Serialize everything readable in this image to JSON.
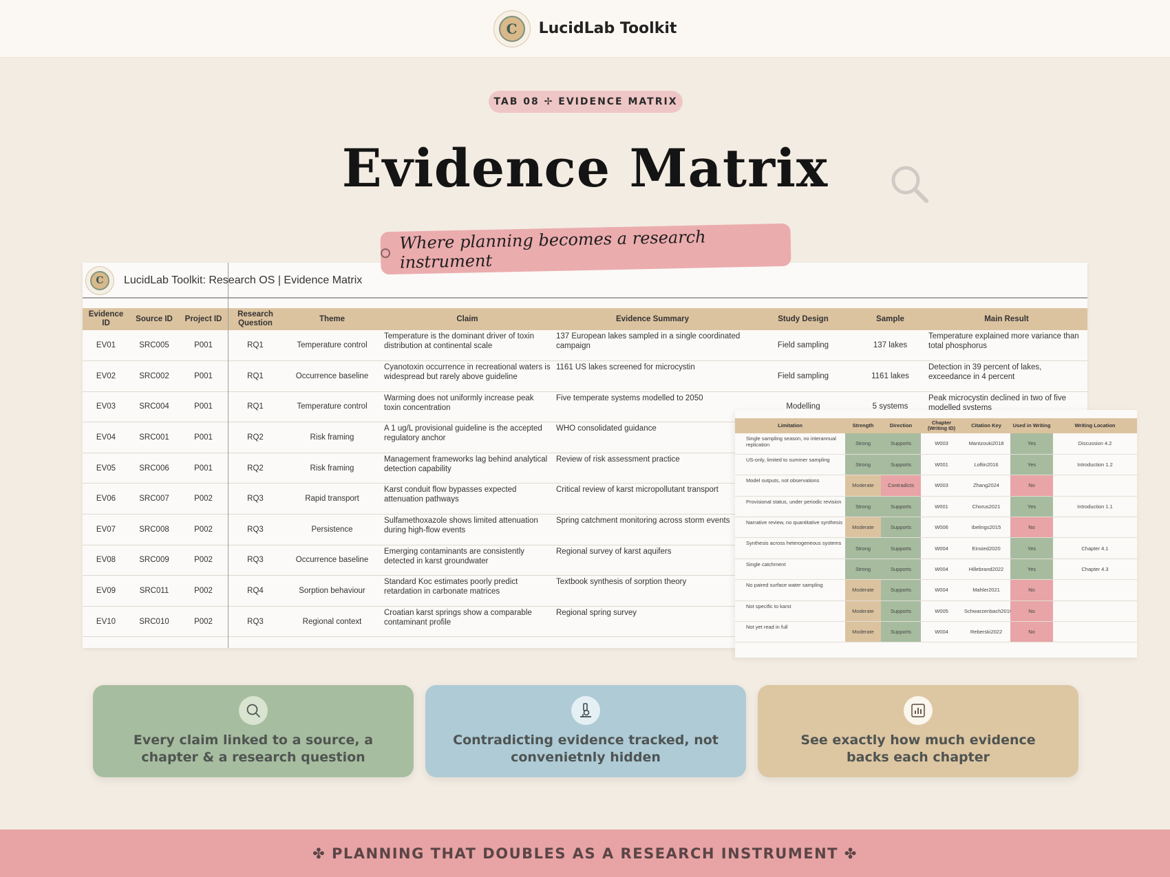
{
  "header": {
    "brand": "LucidLab Toolkit"
  },
  "hero": {
    "tag": "TAB 08 ✢ EVIDENCE MATRIX",
    "title": "Evidence Matrix",
    "tagline": "Where planning becomes a research instrument"
  },
  "sheet": {
    "title": "LucidLab Toolkit: Research OS  |  Evidence Matrix",
    "columns": [
      "Evidence ID",
      "Source ID",
      "Project ID",
      "Research Question",
      "Theme",
      "Claim",
      "Evidence Summary",
      "Study Design",
      "Sample",
      "Main Result"
    ],
    "rows": [
      [
        "EV01",
        "SRC005",
        "P001",
        "RQ1",
        "Temperature control",
        "Temperature is the dominant driver of toxin distribution at continental scale",
        "137 European lakes sampled in a single coordinated campaign",
        "Field sampling",
        "137 lakes",
        "Temperature explained more variance than total phosphorus"
      ],
      [
        "EV02",
        "SRC002",
        "P001",
        "RQ1",
        "Occurrence baseline",
        "Cyanotoxin occurrence in recreational waters is widespread but rarely above guideline",
        "1161 US lakes screened for microcystin",
        "Field sampling",
        "1161 lakes",
        "Detection in 39 percent of lakes, exceedance in 4 percent"
      ],
      [
        "EV03",
        "SRC004",
        "P001",
        "RQ1",
        "Temperature control",
        "Warming does not uniformly increase peak toxin concentration",
        "Five temperate systems modelled to 2050",
        "Modelling",
        "5 systems",
        "Peak microcystin declined in two of five modelled systems"
      ],
      [
        "EV04",
        "SRC001",
        "P001",
        "RQ2",
        "Risk framing",
        "A 1 ug/L provisional guideline is the accepted regulatory anchor",
        "WHO consolidated guidance",
        "",
        "",
        ""
      ],
      [
        "EV05",
        "SRC006",
        "P001",
        "RQ2",
        "Risk framing",
        "Management frameworks lag behind analytical detection capability",
        "Review of risk assessment practice",
        "",
        "",
        ""
      ],
      [
        "EV06",
        "SRC007",
        "P002",
        "RQ3",
        "Rapid transport",
        "Karst conduit flow bypasses expected attenuation pathways",
        "Critical review of karst micropollutant transport",
        "",
        "",
        ""
      ],
      [
        "EV07",
        "SRC008",
        "P002",
        "RQ3",
        "Persistence",
        "Sulfamethoxazole shows limited attenuation during high-flow events",
        "Spring catchment monitoring across storm events",
        "",
        "",
        ""
      ],
      [
        "EV08",
        "SRC009",
        "P002",
        "RQ3",
        "Occurrence baseline",
        "Emerging contaminants are consistently detected in karst groundwater",
        "Regional survey of karst aquifers",
        "",
        "",
        ""
      ],
      [
        "EV09",
        "SRC011",
        "P002",
        "RQ4",
        "Sorption behaviour",
        "Standard Koc estimates poorly predict retardation in carbonate matrices",
        "Textbook synthesis of sorption theory",
        "",
        "",
        ""
      ],
      [
        "EV10",
        "SRC010",
        "P002",
        "RQ3",
        "Regional context",
        "Croatian karst springs show a comparable contaminant profile",
        "Regional spring survey",
        "",
        "",
        ""
      ]
    ]
  },
  "overlay": {
    "columns": [
      "Limitation",
      "Strength",
      "Direction",
      "Chapter (Writing ID)",
      "Citation Key",
      "Used in Writing",
      "Writing Location"
    ],
    "rows": [
      [
        "Single sampling season, no interannual replication",
        "Strong",
        "Supports",
        "W003",
        "Mantzouki2018",
        "Yes",
        "Discussion 4.2"
      ],
      [
        "US-only, limited to summer sampling",
        "Strong",
        "Supports",
        "W001",
        "Loftin2016",
        "Yes",
        "Introduction 1.2"
      ],
      [
        "Model outputs, not observations",
        "Moderate",
        "Contradicts",
        "W003",
        "Zhang2024",
        "No",
        ""
      ],
      [
        "Provisional status, under periodic revision",
        "Strong",
        "Supports",
        "W001",
        "Chorus2021",
        "Yes",
        "Introduction 1.1"
      ],
      [
        "Narrative review, no quantitative synthesis",
        "Moderate",
        "Supports",
        "W006",
        "Ibelings2015",
        "No",
        ""
      ],
      [
        "Synthesis across heterogeneous systems",
        "Strong",
        "Supports",
        "W004",
        "Einsied2020",
        "Yes",
        "Chapter 4.1"
      ],
      [
        "Single catchment",
        "Strong",
        "Supports",
        "W004",
        "Hillebrand2022",
        "Yes",
        "Chapter 4.3"
      ],
      [
        "No paired surface water sampling",
        "Moderate",
        "Supports",
        "W004",
        "Mahler2021",
        "No",
        ""
      ],
      [
        "Not specific to karst",
        "Moderate",
        "Supports",
        "W005",
        "Schwarzenbach2010",
        "No",
        ""
      ],
      [
        "Not yet read in full",
        "Moderate",
        "Supports",
        "W004",
        "Reberski2022",
        "No",
        ""
      ]
    ]
  },
  "features": [
    {
      "icon": "search-icon",
      "text": "Every claim linked to a source, a chapter & a research question"
    },
    {
      "icon": "microscope-icon",
      "text": "Contradicting evidence tracked, not convenietnly hidden"
    },
    {
      "icon": "bar-chart-icon",
      "text": "See exactly how much evidence backs each chapter"
    }
  ],
  "footer": {
    "text": "✤ PLANNING THAT DOUBLES AS A RESEARCH INSTRUMENT ✤"
  },
  "colors": {
    "background": "#f3ece2",
    "pink": "#e8a3a5",
    "green": "#a7bd9f",
    "blue": "#aecbd6",
    "tan": "#ddc6a2",
    "header_tan": "#dcc3a0",
    "red_cell": "#e8a4a6"
  }
}
